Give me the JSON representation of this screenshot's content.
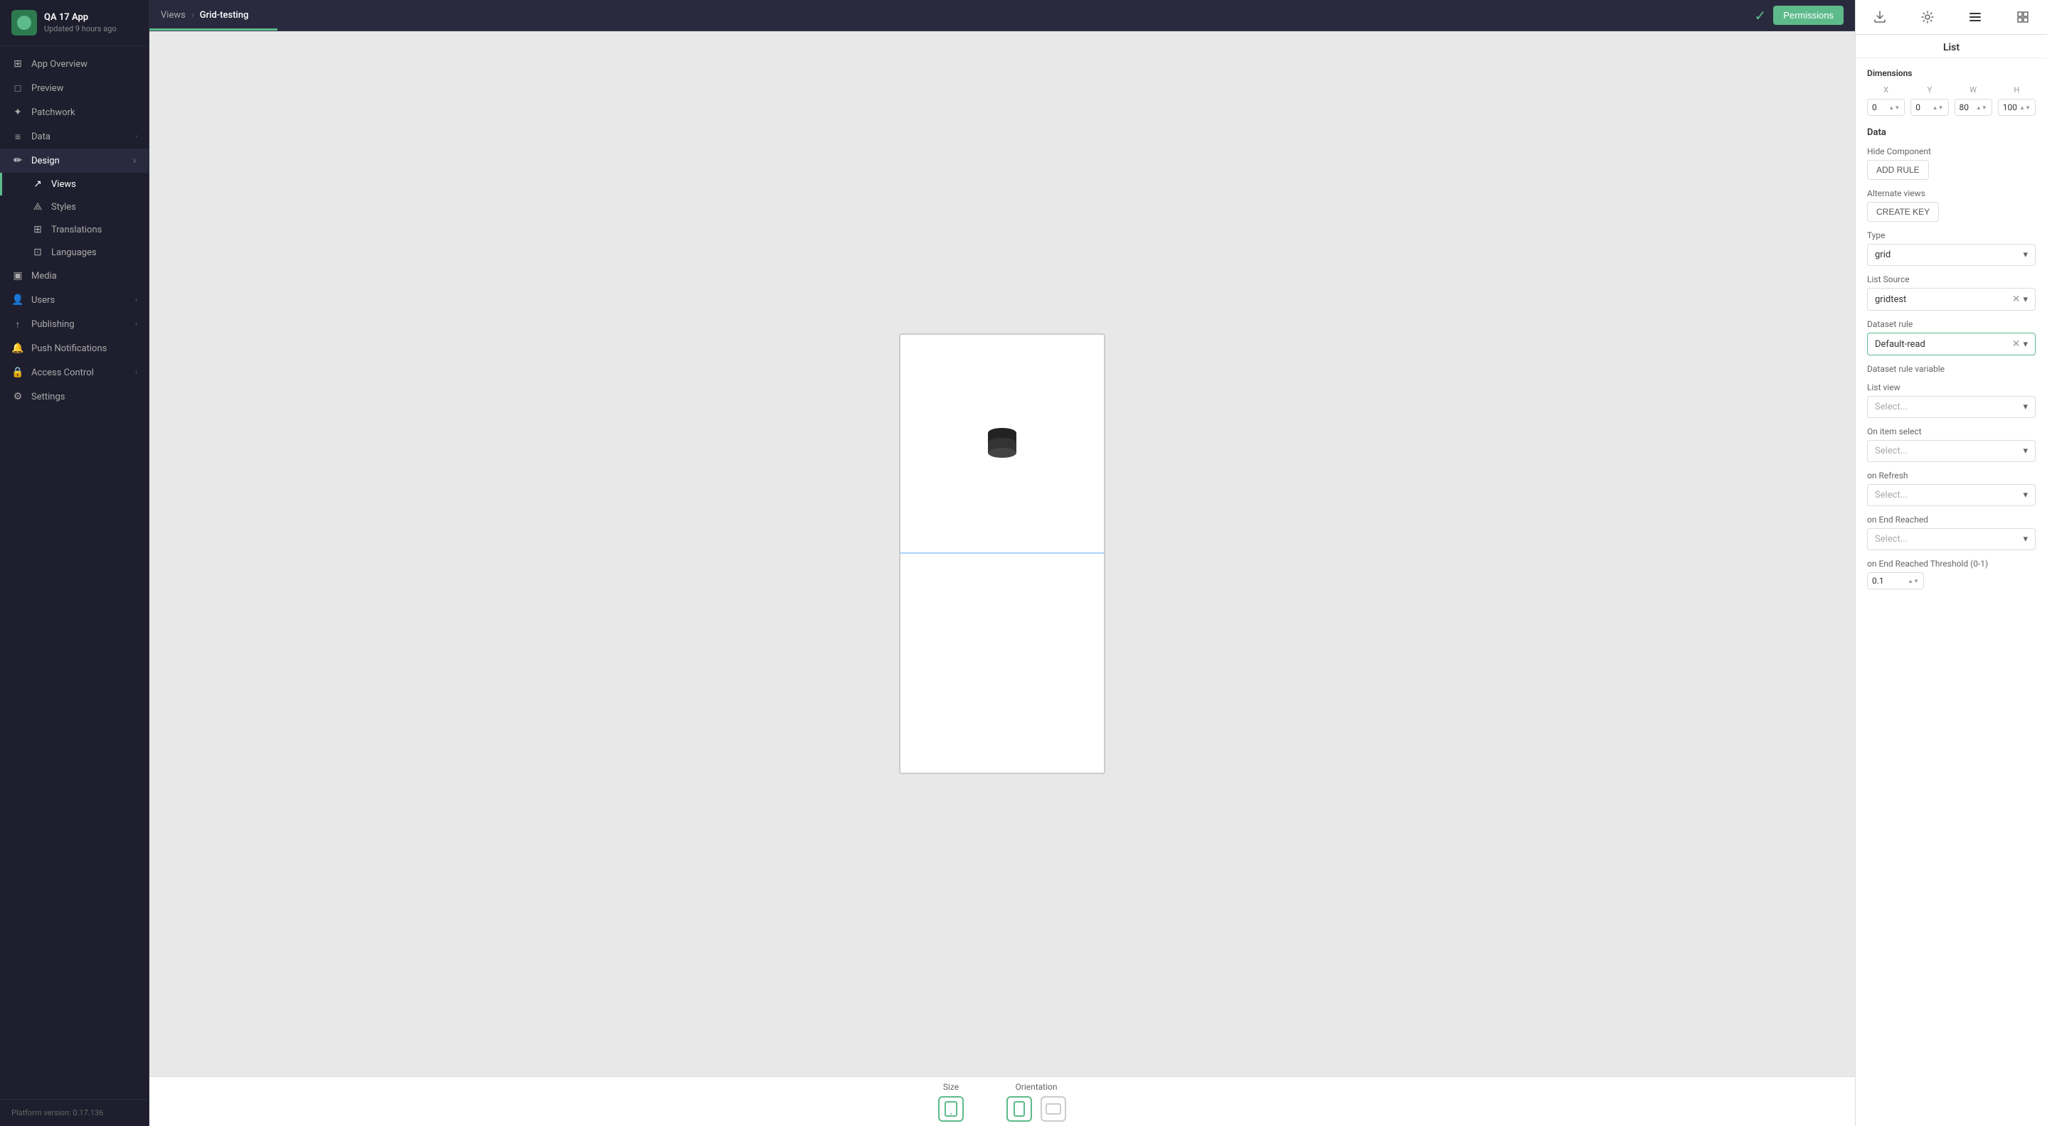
{
  "app": {
    "icon_bg": "#2d7a4f",
    "name": "QA 17 App",
    "updated": "Updated 9 hours ago"
  },
  "sidebar": {
    "items": [
      {
        "id": "app-overview",
        "label": "App Overview",
        "icon": "⊞",
        "type": "item"
      },
      {
        "id": "preview",
        "label": "Preview",
        "icon": "□",
        "type": "item"
      },
      {
        "id": "patchwork",
        "label": "Patchwork",
        "icon": "✦",
        "type": "item"
      },
      {
        "id": "data",
        "label": "Data",
        "icon": "≡",
        "type": "expandable",
        "expanded": false
      },
      {
        "id": "design",
        "label": "Design",
        "icon": "✏",
        "type": "expandable",
        "expanded": true
      }
    ],
    "design_subitems": [
      {
        "id": "views",
        "label": "Views",
        "active": true
      },
      {
        "id": "styles",
        "label": "Styles"
      },
      {
        "id": "translations",
        "label": "Translations"
      },
      {
        "id": "languages",
        "label": "Languages"
      }
    ],
    "bottom_items": [
      {
        "id": "media",
        "label": "Media",
        "icon": "▣"
      },
      {
        "id": "users",
        "label": "Users",
        "icon": "👤",
        "expandable": true
      },
      {
        "id": "publishing",
        "label": "Publishing",
        "icon": "↑",
        "expandable": true
      },
      {
        "id": "push-notifications",
        "label": "Push Notifications",
        "icon": "🔔"
      },
      {
        "id": "access-control",
        "label": "Access Control",
        "icon": "🔒",
        "expandable": true
      },
      {
        "id": "settings",
        "label": "Settings",
        "icon": "⚙"
      }
    ],
    "footer": "Platform version:  0.17.136"
  },
  "topbar": {
    "breadcrumb_root": "Views",
    "breadcrumb_current": "Grid-testing",
    "permissions_label": "Permissions"
  },
  "right_panel": {
    "title": "List",
    "tabs": [
      {
        "id": "download",
        "icon": "⬇"
      },
      {
        "id": "settings",
        "icon": "⚙"
      },
      {
        "id": "layout",
        "icon": "☰"
      },
      {
        "id": "layers",
        "icon": "◫"
      }
    ],
    "dimensions": {
      "title": "Dimensions",
      "labels": [
        "X",
        "Y",
        "W",
        "H"
      ],
      "values": [
        "0",
        "0",
        "80",
        "100"
      ]
    },
    "data_section": {
      "title": "Data",
      "hide_component_label": "Hide Component",
      "add_rule_label": "ADD RULE",
      "alternate_views_label": "Alternate views",
      "create_key_label": "CREATE KEY",
      "type_label": "Type",
      "type_value": "grid",
      "list_source_label": "List Source",
      "list_source_value": "gridtest",
      "dataset_rule_label": "Dataset rule",
      "dataset_rule_value": "Default-read",
      "dataset_rule_variable_label": "Dataset rule variable",
      "list_view_label": "List view",
      "list_view_placeholder": "Select...",
      "on_item_select_label": "On item select",
      "on_item_select_placeholder": "Select...",
      "on_refresh_label": "on Refresh",
      "on_refresh_placeholder": "Select...",
      "on_end_reached_label": "on End Reached",
      "on_end_reached_placeholder": "Select...",
      "on_end_threshold_label": "on End Reached Threshold (0-1)",
      "on_end_threshold_value": "0.1"
    }
  },
  "bottom_toolbar": {
    "size_label": "Size",
    "orientation_label": "Orientation",
    "size_phone_icon": "📱",
    "orientation_portrait_icon": "📱",
    "orientation_landscape_icon": "📱"
  }
}
